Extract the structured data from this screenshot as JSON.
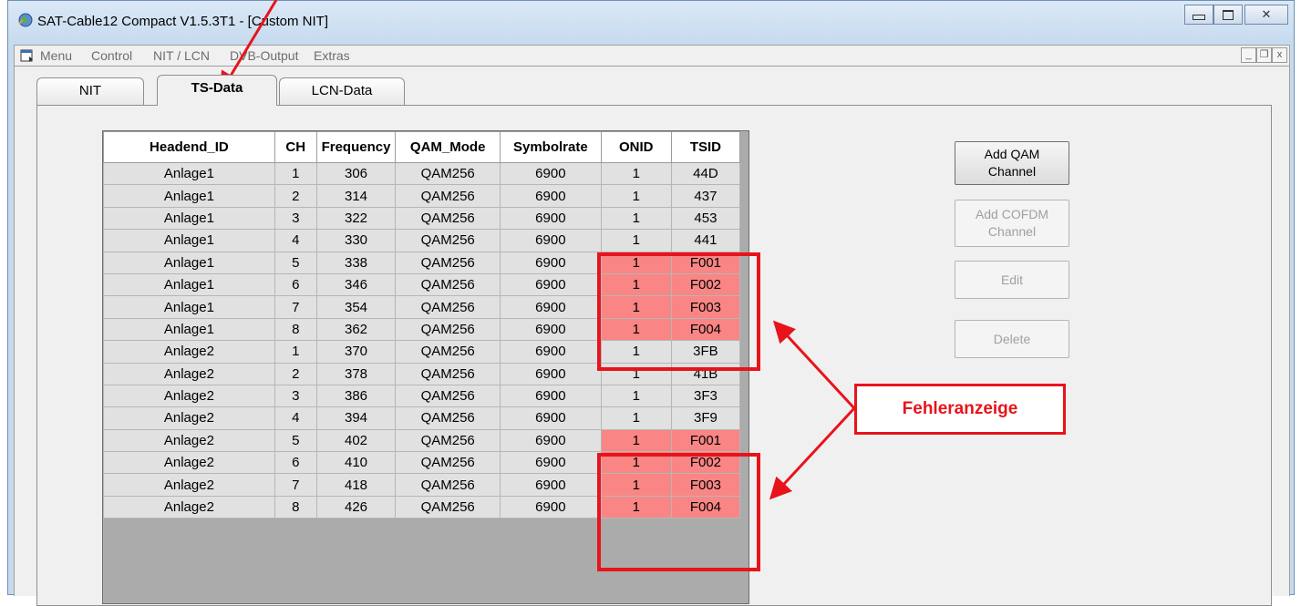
{
  "window": {
    "title": "SAT-Cable12 Compact V1.5.3T1 - [Custom NIT]",
    "minimize_glyph": "▭",
    "maximize_glyph": "▣",
    "close_glyph": "✕"
  },
  "menubar": {
    "items": [
      "Menu",
      "Control",
      "NIT / LCN",
      "DVB-Output",
      "Extras"
    ],
    "mdi_minimize": "_",
    "mdi_restore": "❐",
    "mdi_close": "x"
  },
  "tabs": [
    {
      "label": "NIT",
      "active": false
    },
    {
      "label": "TS-Data",
      "active": true
    },
    {
      "label": "LCN-Data",
      "active": false
    }
  ],
  "table": {
    "columns": [
      "Headend_ID",
      "CH",
      "Frequency",
      "QAM_Mode",
      "Symbolrate",
      "ONID",
      "TSID"
    ],
    "rows": [
      {
        "cells": [
          "Anlage1",
          "1",
          "306",
          "QAM256",
          "6900",
          "1",
          "44D"
        ],
        "error": false
      },
      {
        "cells": [
          "Anlage1",
          "2",
          "314",
          "QAM256",
          "6900",
          "1",
          "437"
        ],
        "error": false
      },
      {
        "cells": [
          "Anlage1",
          "3",
          "322",
          "QAM256",
          "6900",
          "1",
          "453"
        ],
        "error": false
      },
      {
        "cells": [
          "Anlage1",
          "4",
          "330",
          "QAM256",
          "6900",
          "1",
          "441"
        ],
        "error": false
      },
      {
        "cells": [
          "Anlage1",
          "5",
          "338",
          "QAM256",
          "6900",
          "1",
          "F001"
        ],
        "error": true
      },
      {
        "cells": [
          "Anlage1",
          "6",
          "346",
          "QAM256",
          "6900",
          "1",
          "F002"
        ],
        "error": true
      },
      {
        "cells": [
          "Anlage1",
          "7",
          "354",
          "QAM256",
          "6900",
          "1",
          "F003"
        ],
        "error": true
      },
      {
        "cells": [
          "Anlage1",
          "8",
          "362",
          "QAM256",
          "6900",
          "1",
          "F004"
        ],
        "error": true
      },
      {
        "cells": [
          "Anlage2",
          "1",
          "370",
          "QAM256",
          "6900",
          "1",
          "3FB"
        ],
        "error": false
      },
      {
        "cells": [
          "Anlage2",
          "2",
          "378",
          "QAM256",
          "6900",
          "1",
          "41B"
        ],
        "error": false
      },
      {
        "cells": [
          "Anlage2",
          "3",
          "386",
          "QAM256",
          "6900",
          "1",
          "3F3"
        ],
        "error": false
      },
      {
        "cells": [
          "Anlage2",
          "4",
          "394",
          "QAM256",
          "6900",
          "1",
          "3F9"
        ],
        "error": false
      },
      {
        "cells": [
          "Anlage2",
          "5",
          "402",
          "QAM256",
          "6900",
          "1",
          "F001"
        ],
        "error": true
      },
      {
        "cells": [
          "Anlage2",
          "6",
          "410",
          "QAM256",
          "6900",
          "1",
          "F002"
        ],
        "error": true
      },
      {
        "cells": [
          "Anlage2",
          "7",
          "418",
          "QAM256",
          "6900",
          "1",
          "F003"
        ],
        "error": true
      },
      {
        "cells": [
          "Anlage2",
          "8",
          "426",
          "QAM256",
          "6900",
          "1",
          "F004"
        ],
        "error": true
      }
    ]
  },
  "buttons": {
    "add_qam": {
      "line1": "Add QAM",
      "line2": "Channel",
      "enabled": true
    },
    "add_cofdm": {
      "line1": "Add COFDM",
      "line2": "Channel",
      "enabled": false
    },
    "edit": {
      "label": "Edit",
      "enabled": false
    },
    "delete": {
      "label": "Delete",
      "enabled": false
    }
  },
  "annotation": {
    "label": "Fehleranzeige",
    "color": "#e8131b"
  },
  "colors": {
    "error_cell": "#f98585",
    "cell": "#e1e1e1"
  }
}
